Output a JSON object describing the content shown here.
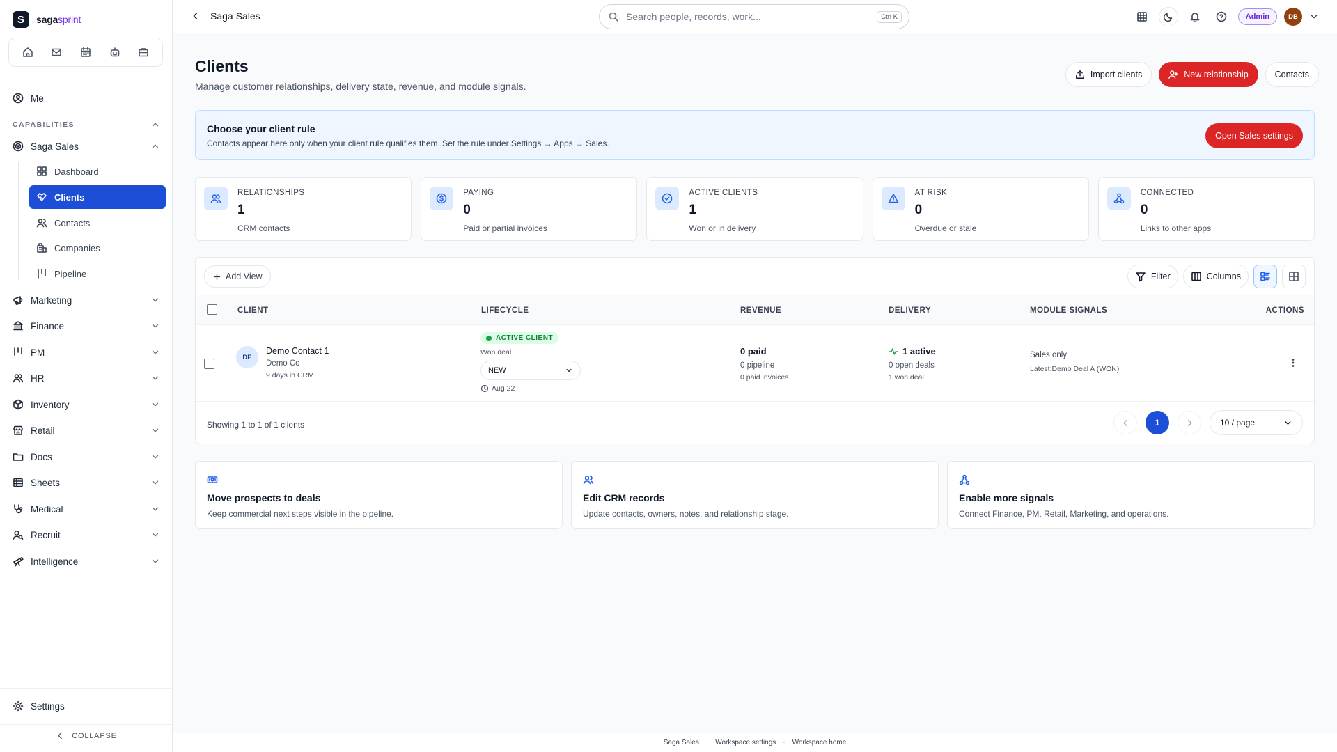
{
  "brand": {
    "name": "saga",
    "accent_name": "sprint"
  },
  "sidebar": {
    "me_label": "Me",
    "capabilities_label": "CAPABILITIES",
    "saga_sales_label": "Saga Sales",
    "sub_items": [
      "Dashboard",
      "Clients",
      "Contacts",
      "Companies",
      "Pipeline"
    ],
    "modules": [
      "Marketing",
      "Finance",
      "PM",
      "HR",
      "Inventory",
      "Retail",
      "Docs",
      "Sheets",
      "Medical",
      "Recruit",
      "Intelligence"
    ],
    "settings_label": "Settings",
    "collapse_label": "COLLAPSE"
  },
  "topbar": {
    "back_label": "Saga Sales",
    "search_placeholder": "Search people, records, work...",
    "search_shortcut": "Ctrl K",
    "admin_label": "Admin",
    "avatar_initials": "DB"
  },
  "page": {
    "title": "Clients",
    "subtitle": "Manage customer relationships, delivery state, revenue, and module signals.",
    "import_label": "Import clients",
    "new_label": "New relationship",
    "contacts_label": "Contacts"
  },
  "banner": {
    "title": "Choose your client rule",
    "description": "Contacts appear here only when your client rule qualifies them. Set the rule under Settings → Apps → Sales.",
    "button_label": "Open Sales settings"
  },
  "stats": [
    {
      "label": "RELATIONSHIPS",
      "value": "1",
      "sub": "CRM contacts",
      "icon": "users-icon"
    },
    {
      "label": "PAYING",
      "value": "0",
      "sub": "Paid or partial invoices",
      "icon": "dollar-icon"
    },
    {
      "label": "ACTIVE CLIENTS",
      "value": "1",
      "sub": "Won or in delivery",
      "icon": "check-circle-icon"
    },
    {
      "label": "AT RISK",
      "value": "0",
      "sub": "Overdue or stale",
      "icon": "warning-icon"
    },
    {
      "label": "CONNECTED",
      "value": "0",
      "sub": "Links to other apps",
      "icon": "network-icon"
    }
  ],
  "table": {
    "add_view_label": "Add View",
    "filter_label": "Filter",
    "columns_label": "Columns",
    "headers": {
      "client": "CLIENT",
      "lifecycle": "LIFECYCLE",
      "revenue": "REVENUE",
      "delivery": "DELIVERY",
      "signals": "MODULE SIGNALS",
      "actions": "ACTIONS"
    },
    "rows": [
      {
        "initials": "DE",
        "name": "Demo Contact 1",
        "company": "Demo Co",
        "age": "9 days in CRM",
        "lifecycle_badge": "ACTIVE CLIENT",
        "lifecycle_sub": "Won deal",
        "stage": "NEW",
        "date": "Aug 22",
        "revenue_main": "0 paid",
        "revenue_pipeline": "0 pipeline",
        "revenue_invoices": "0 paid invoices",
        "delivery_main": "1 active",
        "delivery_open": "0 open deals",
        "delivery_won": "1 won deal",
        "signal_main": "Sales only",
        "signal_latest": "Latest:Demo Deal A (WON)"
      }
    ],
    "showing": "Showing 1 to 1 of 1 clients",
    "current_page": "1",
    "per_page": "10 / page"
  },
  "cards": [
    {
      "title": "Move prospects to deals",
      "description": "Keep commercial next steps visible in the pipeline.",
      "icon": "money-icon"
    },
    {
      "title": "Edit CRM records",
      "description": "Update contacts, owners, notes, and relationship stage.",
      "icon": "users-icon"
    },
    {
      "title": "Enable more signals",
      "description": "Connect Finance, PM, Retail, Marketing, and operations.",
      "icon": "network-icon"
    }
  ],
  "footer": {
    "links": [
      "Saga Sales",
      "Workspace settings",
      "Workspace home"
    ]
  },
  "colors": {
    "primary": "#1d4ed8",
    "danger": "#dc2626",
    "success": "#16a34a",
    "accent": "#7c3aed"
  }
}
